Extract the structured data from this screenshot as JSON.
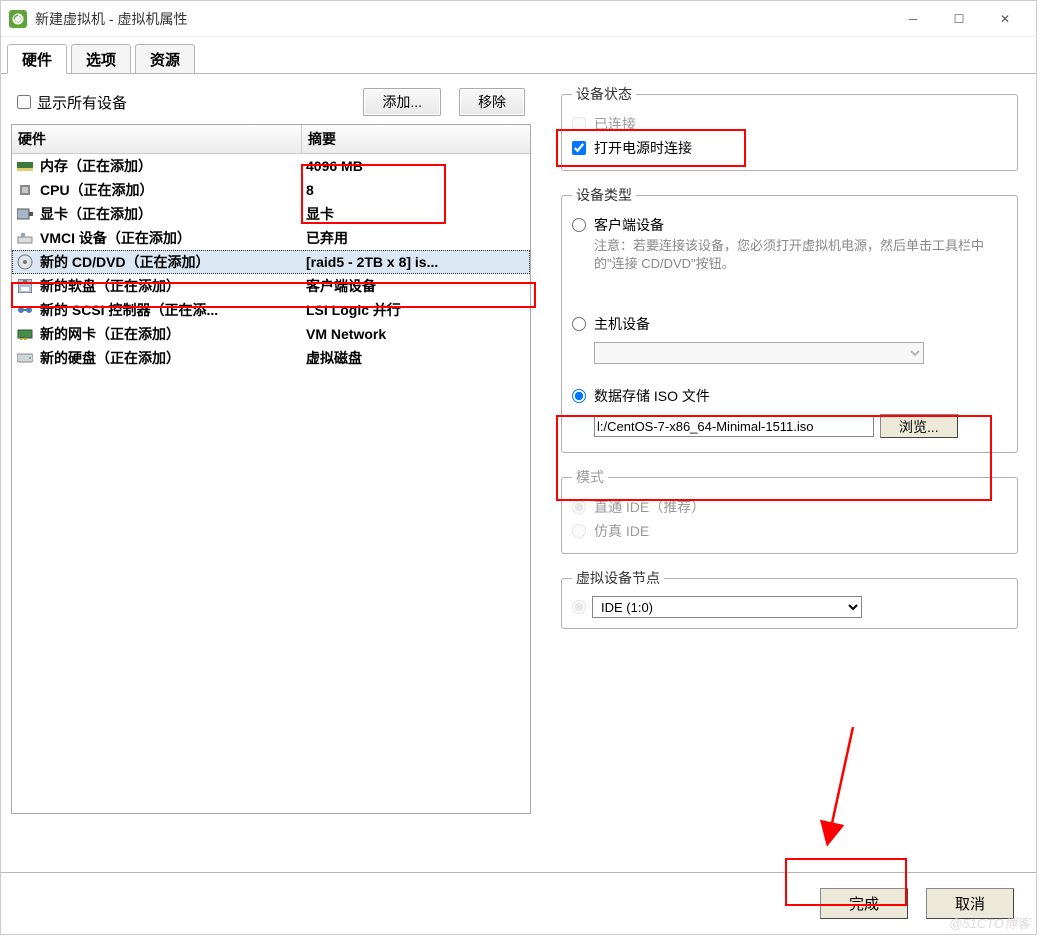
{
  "window": {
    "title": "新建虚拟机 - 虚拟机属性"
  },
  "tabs": {
    "hardware": "硬件",
    "options": "选项",
    "resources": "资源"
  },
  "left": {
    "show_all_devices_label": "显示所有设备",
    "add_button": "添加...",
    "remove_button": "移除",
    "columns": {
      "hardware": "硬件",
      "summary": "摘要"
    },
    "rows": [
      {
        "icon": "memory",
        "name": "内存（正在添加）",
        "summary": "4096 MB"
      },
      {
        "icon": "cpu",
        "name": "CPU（正在添加）",
        "summary": "8"
      },
      {
        "icon": "gpu",
        "name": "显卡（正在添加）",
        "summary": "显卡"
      },
      {
        "icon": "vmci",
        "name": "VMCI 设备（正在添加）",
        "summary": "已弃用"
      },
      {
        "icon": "cd",
        "name": "新的 CD/DVD（正在添加）",
        "summary": "[raid5 - 2TB x 8] is...",
        "selected": true
      },
      {
        "icon": "floppy",
        "name": "新的软盘（正在添加）",
        "summary": "客户端设备"
      },
      {
        "icon": "scsi",
        "name": "新的 SCSI 控制器（正在添...",
        "summary": "LSI Logic 并行"
      },
      {
        "icon": "nic",
        "name": "新的网卡（正在添加）",
        "summary": "VM Network"
      },
      {
        "icon": "hdd",
        "name": "新的硬盘（正在添加）",
        "summary": "虚拟磁盘"
      }
    ]
  },
  "right": {
    "status_legend": "设备状态",
    "connected_label": "已连接",
    "connect_at_power_label": "打开电源时连接",
    "device_type_legend": "设备类型",
    "client_device_label": "客户端设备",
    "client_device_note": "注意：若要连接该设备，您必须打开虚拟机电源，然后单击工具栏中的\"连接 CD/DVD\"按钮。",
    "host_device_label": "主机设备",
    "host_device_value": "",
    "datastore_iso_label": "数据存储 ISO 文件",
    "datastore_iso_value": "l:/CentOS-7-x86_64-Minimal-1511.iso",
    "browse_button": "浏览...",
    "mode_legend": "模式",
    "passthrough_label": "直通 IDE（推荐）",
    "emulate_label": "仿真 IDE",
    "vdev_node_legend": "虚拟设备节点",
    "vdev_node_value": "IDE (1:0)"
  },
  "footer": {
    "finish": "完成",
    "cancel": "取消"
  },
  "watermark": "@51CTO博客"
}
